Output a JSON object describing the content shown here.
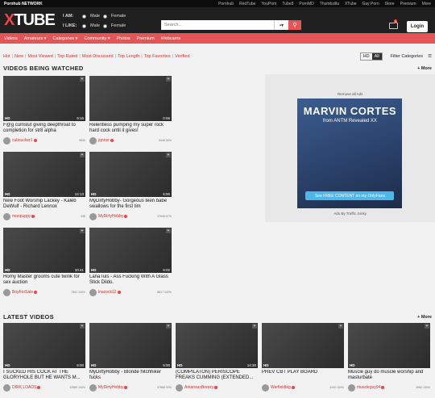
{
  "network": {
    "brand": "Pornhub NETWORK",
    "links": [
      "Pornhub",
      "RedTube",
      "YouPorn",
      "Tube8",
      "PornMD",
      "Thumbzilla",
      "XTube",
      "Gay Porn",
      "Store",
      "Premium",
      "More"
    ]
  },
  "header": {
    "logo_x": "X",
    "logo_rest": "TUBE",
    "iam_label": "I AM:",
    "ilike_label": "I LIKE:",
    "male": "Male",
    "female": "Female",
    "search_placeholder": "Search...",
    "cam_icon": "camera-icon",
    "mail_badge": "4",
    "login": "Login"
  },
  "main_nav": [
    "Videos",
    "Amateurs ▾",
    "Categories ▾",
    "Community ▾",
    "Photos",
    "Premium",
    "Webcams"
  ],
  "filters": [
    "Hot",
    "New",
    "Most Viewed",
    "Top Rated",
    "Most Discussed",
    "Top Length",
    "Top Favorites",
    "Verified"
  ],
  "hd_toggle": {
    "hd": "HD",
    "all": "All"
  },
  "filter_categories": "Filter Categories",
  "watched": {
    "title": "VIDEOS BEING WATCHED",
    "more": "+ More",
    "videos": [
      {
        "title": "F@g cumslut giving deepthroat to completion for str8 alpha",
        "hd": "HD",
        "duration": "9:16",
        "uploader": "cubsucker1",
        "stats": "9840"
      },
      {
        "title": "Relentless pumping my super rock hard cock until it gives!",
        "hd": "",
        "duration": "0:06",
        "uploader": "jqnner",
        "stats": "6446 96%"
      },
      {
        "title": "New Foot Worship Lackey - Kaleb DeWulf - Richard Lennox",
        "hd": "HD",
        "duration": "12:13",
        "uploader": "manpuppy",
        "stats": "948"
      },
      {
        "title": "MyDirtyHobby- Gorgeous teen babe swallows for the first tim",
        "hd": "HD",
        "duration": "5:00",
        "uploader": "MyDirtyHobby",
        "stats": "37946 97%"
      },
      {
        "title": "Horny Master grooms cute twink for sex auction",
        "hd": "HD",
        "duration": "10:41",
        "uploader": "BoyForSale",
        "stats": "7902 100%"
      },
      {
        "title": "LanaTuls - Ass Fucking With A Glass Stick Dildo.",
        "hd": "HD",
        "duration": "6:02",
        "uploader": "lnacock12",
        "stats": "8817 100%"
      }
    ]
  },
  "ad": {
    "remove": "Remove all Ads",
    "name": "MARVIN CORTES",
    "sub": "from ANTM Revealed XX",
    "cta": "See FREE CONTENT on my OnlyFans",
    "foot": "Ads By Traffic Junky"
  },
  "latest": {
    "title": "LATEST VIDEOS",
    "more": "+ More",
    "videos": [
      {
        "title": "I SUCKED HIS COCK AT THE GLORYHOLE BUT HE WANTS M...",
        "hd": "HD",
        "duration": "5:00",
        "uploader": "DIRK LOADS",
        "stats": "12580 100%"
      },
      {
        "title": "MyDirtyHobby - Blonde hitchhiker fucks",
        "hd": "HD",
        "duration": "5:00",
        "uploader": "MyDirtyHobby",
        "stats": "47868 93%"
      },
      {
        "title": "(COMPILATON) PERISCOPE FREAKS CUMMING (EXTENDED...",
        "hd": "HD",
        "duration": "14:30",
        "uploader": "ArkansasBreezy",
        "stats": ""
      },
      {
        "title": "PREV CBT PLAY BOARD",
        "hd": "HD",
        "duration": "",
        "uploader": "Warfieldbig",
        "stats": "4100 100%"
      },
      {
        "title": "Muscle guy do muscle worship and masturbate",
        "hd": "HD",
        "duration": "",
        "uploader": "muscleguy94",
        "stats": "3980 100%"
      }
    ]
  }
}
